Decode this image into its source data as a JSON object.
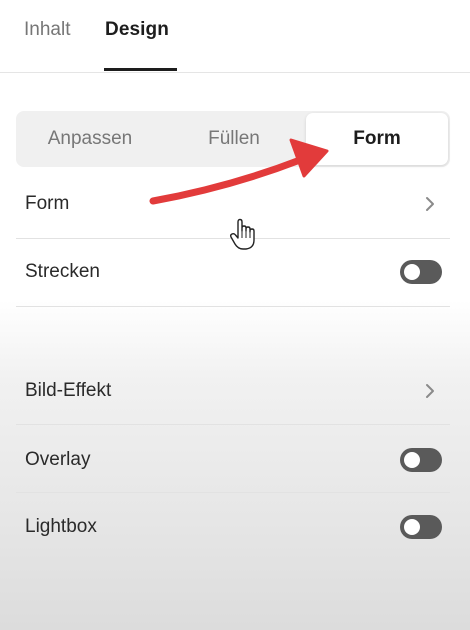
{
  "top_tabs": {
    "inhalt": "Inhalt",
    "design": "Design",
    "active": "Design"
  },
  "segmented": {
    "options": [
      "Anpassen",
      "Füllen",
      "Form"
    ],
    "selected": "Form"
  },
  "rows": {
    "form": {
      "label": "Form",
      "control": "chevron-right-icon"
    },
    "strecken": {
      "label": "Strecken",
      "control": "toggle",
      "on": false
    },
    "bild_effekt": {
      "label": "Bild-Effekt",
      "control": "chevron-right-icon"
    },
    "overlay": {
      "label": "Overlay",
      "control": "toggle",
      "on": false
    },
    "lightbox": {
      "label": "Lightbox",
      "control": "toggle",
      "on": false
    }
  },
  "colors": {
    "arrow": "#e23b3b",
    "toggle_off": "#5a5a5a",
    "text": "#2a2a2a",
    "muted": "#777777"
  },
  "icons": {
    "annotation": "red-arrow-icon",
    "pointer": "hand-cursor-icon"
  }
}
